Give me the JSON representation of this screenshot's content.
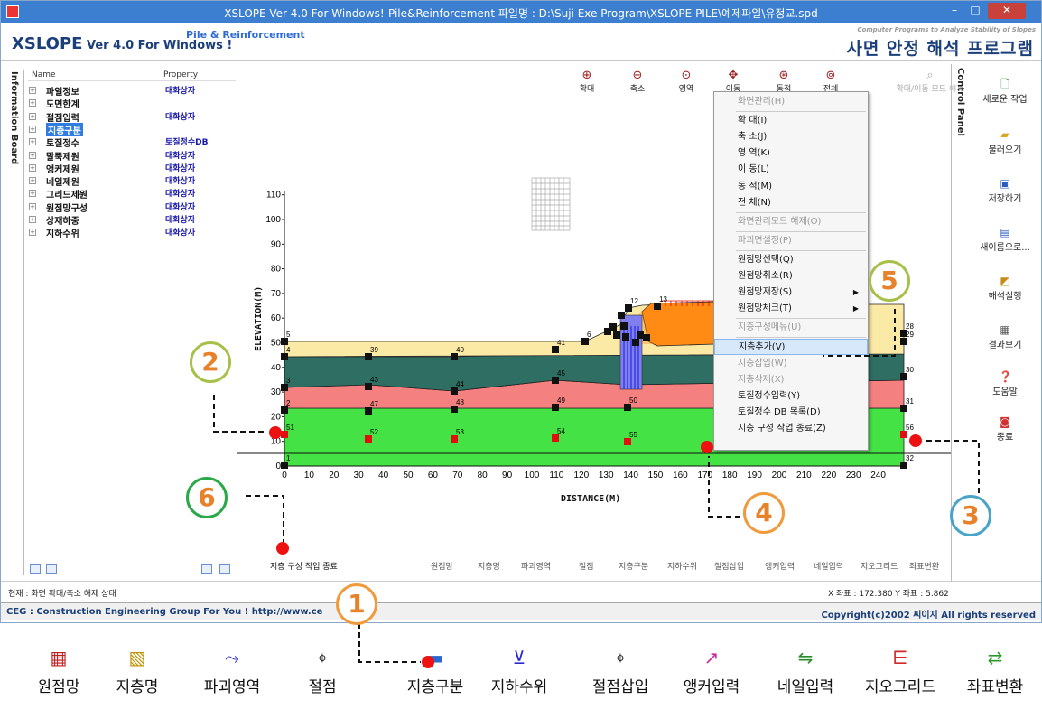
{
  "window": {
    "title": "XSLOPE Ver 4.0 For Windows!-Pile&Reinforcement  파일명 : D:\\Suji Exe Program\\XSLOPE PILE\\예제파일\\유정교.spd",
    "minimize": "–",
    "maximize": "□",
    "close": "✕"
  },
  "header": {
    "brand": "XSLOPE",
    "version": " Ver 4.0 For Windows !",
    "sub": "Pile & Reinforcement",
    "right_small": "Computer Programs to Analyze Stability of Slopes",
    "right_big": "사면 안정 해석 프로그램"
  },
  "info_board": {
    "tab_label": "Information Board",
    "columns": [
      "Name",
      "Property"
    ],
    "items": [
      {
        "name": "파일정보",
        "property": "대화상자"
      },
      {
        "name": "도면한계",
        "property": ""
      },
      {
        "name": "절점입력",
        "property": "대화상자"
      },
      {
        "name": "지층구분",
        "property": ""
      },
      {
        "name": "토질정수",
        "property": "토질정수DB"
      },
      {
        "name": "말뚝제원",
        "property": "대화상자"
      },
      {
        "name": "앵커제원",
        "property": "대화상자"
      },
      {
        "name": "네일제원",
        "property": "대화상자"
      },
      {
        "name": "그리드제원",
        "property": "대화상자"
      },
      {
        "name": "원점망구성",
        "property": "대화상자"
      },
      {
        "name": "상재하중",
        "property": "대화상자"
      },
      {
        "name": "지하수위",
        "property": "대화상자"
      }
    ],
    "selected_index": 3
  },
  "zoom_toolbar": [
    "확대",
    "축소",
    "영역",
    "이동",
    "동적",
    "전체",
    "확대/이동 모드 해제"
  ],
  "plot": {
    "y_axis_label": "ELEVATION(M)",
    "x_axis_label": "DISTANCE(M)",
    "y_ticks": [
      0,
      10,
      20,
      30,
      40,
      50,
      60,
      70,
      80,
      90,
      100,
      110
    ],
    "x_ticks": [
      0,
      10,
      20,
      30,
      40,
      50,
      60,
      70,
      80,
      90,
      100,
      110,
      120,
      130,
      140,
      150,
      160,
      170,
      180,
      190,
      200,
      210,
      220,
      230,
      240
    ],
    "node_labels": [
      "1",
      "2",
      "3",
      "4",
      "5",
      "6",
      "12",
      "13",
      "28",
      "29",
      "30",
      "31",
      "32",
      "39",
      "40",
      "41",
      "43",
      "44",
      "45",
      "47",
      "48",
      "49",
      "50",
      "51",
      "52",
      "53",
      "54",
      "55",
      "56"
    ],
    "bottom_tools": [
      "원점망",
      "지층명",
      "파괴영역",
      "절점",
      "지층구분",
      "지하수위",
      "절점삽입",
      "앵커입력",
      "네일입력",
      "지오그리드",
      "좌표변환"
    ],
    "finish_label": "지층 구성 작업 종료"
  },
  "context_menu": {
    "items": [
      {
        "label": "화면관리(H)",
        "disabled": true
      },
      {
        "label": "확    대(I)",
        "disabled": false
      },
      {
        "label": "축    소(J)",
        "disabled": false
      },
      {
        "label": "영    역(K)",
        "disabled": false
      },
      {
        "label": "이    동(L)",
        "disabled": false
      },
      {
        "label": "동    적(M)",
        "disabled": false
      },
      {
        "label": "전    체(N)",
        "disabled": false
      },
      {
        "label": "화면관리모드 해제(O)",
        "disabled": true
      },
      {
        "label": "파괴면설정(P)",
        "disabled": true
      },
      {
        "label": "원점망선택(Q)",
        "disabled": false
      },
      {
        "label": "원점망취소(R)",
        "disabled": false
      },
      {
        "label": "원점망저장(S)",
        "disabled": false,
        "submenu": true
      },
      {
        "label": "원점망체크(T)",
        "disabled": false,
        "submenu": true
      },
      {
        "label": "지층구성메뉴(U)",
        "disabled": true
      },
      {
        "label": "지층추가(V)",
        "disabled": false,
        "active": true
      },
      {
        "label": "지층삽입(W)",
        "disabled": true
      },
      {
        "label": "지층삭제(X)",
        "disabled": true
      },
      {
        "label": "토질정수입력(Y)",
        "disabled": false
      },
      {
        "label": "토질정수 DB 목록(D)",
        "disabled": false
      },
      {
        "label": "지층 구성 작업 종료(Z)",
        "disabled": false
      }
    ]
  },
  "control_panel": {
    "tab_label": "Control Panel",
    "buttons": [
      "새로운 작업",
      "불러오기",
      "저장하기",
      "새이름으로...",
      "해석실행",
      "결과보기",
      "도움말",
      "종료"
    ]
  },
  "status": {
    "left": "현재 : 화면 확대/축소 해제 상태",
    "right": "X 좌표 :   172.380  Y 좌표 :    5.862"
  },
  "footer": {
    "left": "CEG : Construction Engineering Group For You ! http://www.ce",
    "right": "Copyright(c)2002 씨이지 All rights reserved"
  },
  "legend": [
    "원점망",
    "지층명",
    "파괴영역",
    "절점",
    "지층구분",
    "지하수위",
    "절점삽입",
    "앵커입력",
    "네일입력",
    "지오그리드",
    "좌표변환"
  ],
  "callouts": [
    "1",
    "2",
    "3",
    "4",
    "5",
    "6"
  ],
  "colors": {
    "titlebar": "#3c7fd0",
    "layer_top": "#fbe9a6",
    "layer_2": "#2f6e62",
    "layer_3": "#f48080",
    "layer_4": "#44e244",
    "fill_orange": "#ff8a14",
    "pile": "#7f7fef",
    "red_marker": "#ee1111"
  }
}
